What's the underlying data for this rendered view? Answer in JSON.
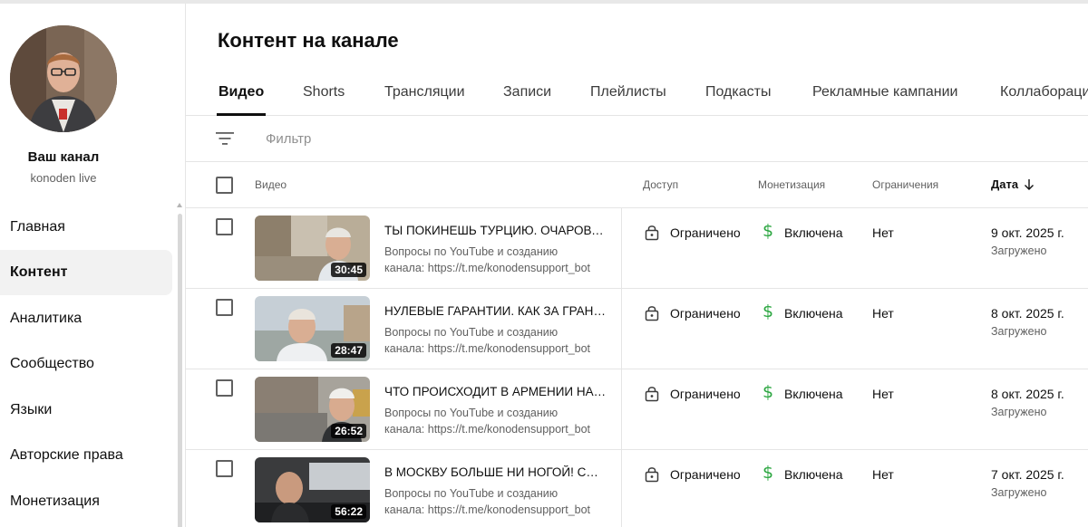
{
  "sidebar": {
    "channel_title": "Ваш канал",
    "channel_handle": "konoden live",
    "items": [
      {
        "label": "Главная"
      },
      {
        "label": "Контент"
      },
      {
        "label": "Аналитика"
      },
      {
        "label": "Сообщество"
      },
      {
        "label": "Языки"
      },
      {
        "label": "Авторские права"
      },
      {
        "label": "Монетизация"
      }
    ],
    "active_index": 1
  },
  "main": {
    "title": "Контент на канале",
    "tabs": [
      {
        "label": "Видео"
      },
      {
        "label": "Shorts"
      },
      {
        "label": "Трансляции"
      },
      {
        "label": "Записи"
      },
      {
        "label": "Плейлисты"
      },
      {
        "label": "Подкасты"
      },
      {
        "label": "Рекламные кампании"
      },
      {
        "label": "Коллаборации"
      }
    ],
    "active_tab": 0,
    "filter_placeholder": "Фильтр",
    "columns": {
      "video": "Видео",
      "access": "Доступ",
      "monetization": "Монетизация",
      "restrictions": "Ограничения",
      "date": "Дата"
    },
    "sort_icon": "arrow-down-icon",
    "videos": [
      {
        "title": "ТЫ ПОКИНЕШЬ ТУРЦИЮ. ОЧАРОВАНИЕ",
        "desc_line1": "Вопросы по YouTube и созданию",
        "desc_line2": "канала: https://t.me/konodensupport_bot",
        "duration": "30:45",
        "access": "Ограничено",
        "monetization": "Включена",
        "restrictions": "Нет",
        "date": "9 окт. 2025 г.",
        "status": "Загружено"
      },
      {
        "title": "НУЛЕВЫЕ ГАРАНТИИ. КАК ЗА ГРАНИЦЕЙ",
        "desc_line1": "Вопросы по YouTube и созданию",
        "desc_line2": "канала: https://t.me/konodensupport_bot",
        "duration": "28:47",
        "access": "Ограничено",
        "monetization": "Включена",
        "restrictions": "Нет",
        "date": "8 окт. 2025 г.",
        "status": "Загружено"
      },
      {
        "title": "ЧТО ПРОИСХОДИТ В АРМЕНИИ НА САМОМ ДЕЛЕ",
        "desc_line1": "Вопросы по YouTube и созданию",
        "desc_line2": "канала: https://t.me/konodensupport_bot",
        "duration": "26:52",
        "access": "Ограничено",
        "monetization": "Включена",
        "restrictions": "Нет",
        "date": "8 окт. 2025 г.",
        "status": "Загружено"
      },
      {
        "title": "В МОСКВУ БОЛЬШЕ НИ НОГОЙ! Смотрите",
        "desc_line1": "Вопросы по YouTube и созданию",
        "desc_line2": "канала: https://t.me/konodensupport_bot",
        "duration": "56:22",
        "access": "Ограничено",
        "monetization": "Включена",
        "restrictions": "Нет",
        "date": "7 окт. 2025 г.",
        "status": "Загружено"
      }
    ]
  },
  "colors": {
    "accent_text": "#0f0f0f",
    "secondary_text": "#606060",
    "monetization_green": "#2ba640",
    "active_nav_bg": "#f2f2f2"
  }
}
